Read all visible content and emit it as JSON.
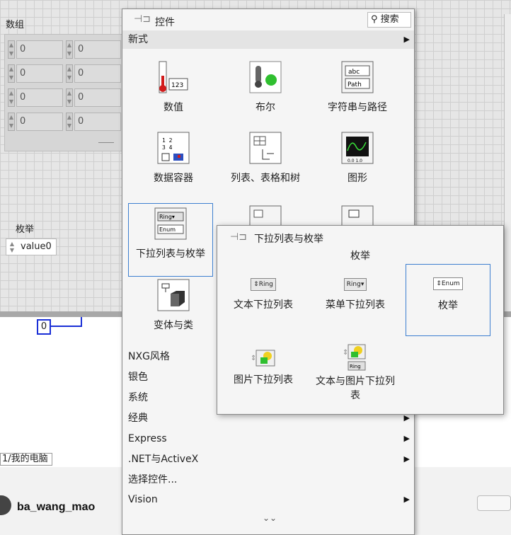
{
  "front_panel": {
    "array_label": "数组",
    "array_values": [
      "0",
      "0",
      "0",
      "0",
      "0",
      "0",
      "0",
      "0"
    ],
    "enum_label": "枚举",
    "enum_value": "value0"
  },
  "block_diagram": {
    "constant_value": "0",
    "path_tab": "1/我的电脑"
  },
  "watermark": "ba_wang_mao",
  "palette": {
    "title": "控件",
    "search_label": "搜索",
    "section_label": "新式",
    "tiles": [
      {
        "label": "数值",
        "icon": "numeric-icon"
      },
      {
        "label": "布尔",
        "icon": "boolean-icon"
      },
      {
        "label": "字符串与路径",
        "icon": "string-path-icon"
      },
      {
        "label": "数据容器",
        "icon": "data-container-icon"
      },
      {
        "label": "列表、表格和树",
        "icon": "list-table-tree-icon"
      },
      {
        "label": "图形",
        "icon": "graph-icon"
      },
      {
        "label": "下拉列表与枚举",
        "icon": "ring-enum-icon"
      },
      {
        "label": "",
        "icon": "container-icon"
      },
      {
        "label": "",
        "icon": "io-icon"
      },
      {
        "label": "变体与类",
        "icon": "variant-class-icon"
      }
    ],
    "categories": [
      {
        "label": "NXG风格",
        "has_arrow": false
      },
      {
        "label": "银色",
        "has_arrow": false
      },
      {
        "label": "系统",
        "has_arrow": false
      },
      {
        "label": "经典",
        "has_arrow": false
      },
      {
        "label": "Express",
        "has_arrow": true
      },
      {
        "label": ".NET与ActiveX",
        "has_arrow": true
      },
      {
        "label": "选择控件...",
        "has_arrow": false
      },
      {
        "label": "Vision",
        "has_arrow": true
      }
    ]
  },
  "submenu": {
    "title": "下拉列表与枚举",
    "section": "枚举",
    "items": [
      {
        "label": "文本下拉列表",
        "icon_text": "Ring"
      },
      {
        "label": "菜单下拉列表",
        "icon_text": "Ring"
      },
      {
        "label": "枚举",
        "icon_text": "Enum"
      },
      {
        "label": "图片下拉列表",
        "icon_text": ""
      },
      {
        "label": "文本与图片下拉列表",
        "icon_text": "Ring"
      }
    ]
  },
  "colors": {
    "accent": "#1a2fd6",
    "highlight": "#3d7fd0",
    "bool_on": "#2fbf2f",
    "thermo_red": "#d21c1c"
  }
}
